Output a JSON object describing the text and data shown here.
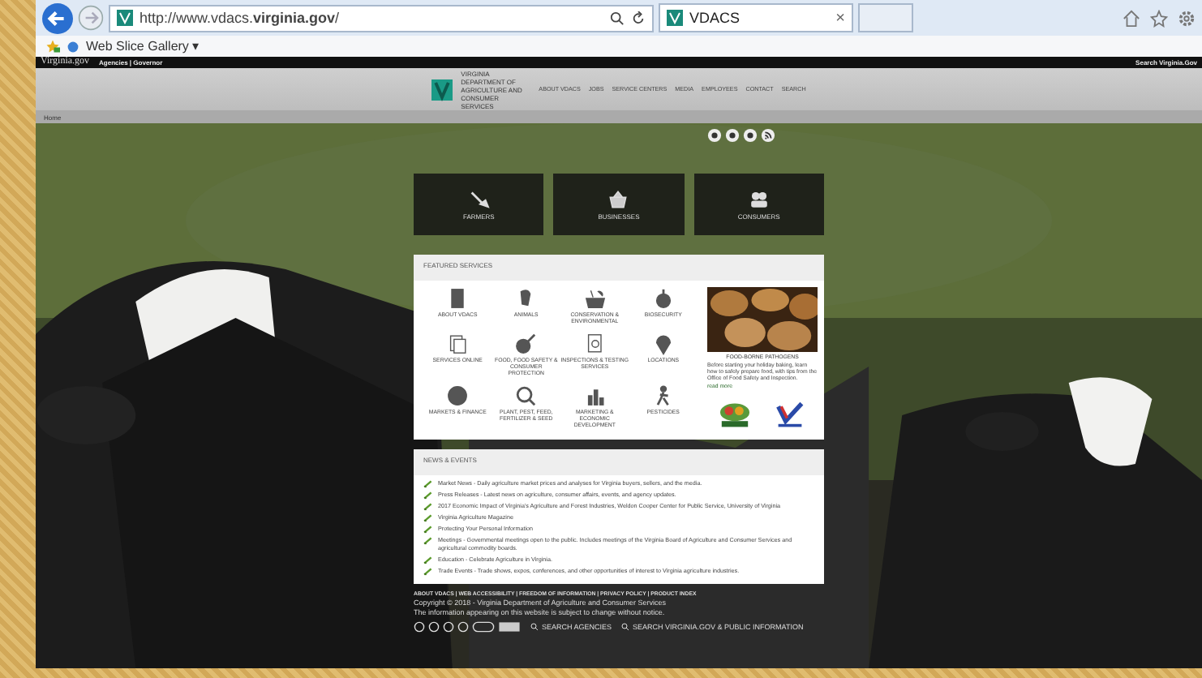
{
  "browser": {
    "address": "http://www.vdacs.**virginia.gov**/",
    "tabs": [
      {
        "label": "VDACS",
        "close": "×",
        "selected": true
      }
    ],
    "favorites": [
      {
        "label": "Web Slice Gallery ▾"
      }
    ]
  },
  "top_bar": {
    "logo": "Virginia.gov",
    "links": "Agencies | Governor",
    "search": "Search Virginia.Gov"
  },
  "header": {
    "agency": "VIRGINIA DEPARTMENT OF AGRICULTURE AND CONSUMER SERVICES",
    "nav": [
      "ABOUT VDACS",
      "JOBS",
      "SERVICE CENTERS",
      "MEDIA",
      "EMPLOYEES",
      "CONTACT",
      "SEARCH"
    ]
  },
  "breadcrumb": "Home",
  "tiles": [
    "FARMERS",
    "BUSINESSES",
    "CONSUMERS"
  ],
  "featured": {
    "title": "FEATURED SERVICES",
    "services": [
      "ABOUT VDACS",
      "ANIMALS",
      "CONSERVATION & ENVIRONMENTAL",
      "BIOSECURITY",
      "SERVICES ONLINE",
      "FOOD, FOOD SAFETY & CONSUMER PROTECTION",
      "INSPECTIONS & TESTING SERVICES",
      "LOCATIONS",
      "MARKETS & FINANCE",
      "PLANT, PEST, FEED, FERTILIZER & SEED",
      "MARKETING & ECONOMIC DEVELOPMENT",
      "PESTICIDES"
    ],
    "spotlight": {
      "caption": "FOOD-BORNE PATHOGENS",
      "text": "Before starting your holiday baking, learn how to safely prepare food, with tips from the Office of Food Safety and Inspection.",
      "link": "read more"
    }
  },
  "news": {
    "title": "NEWS & EVENTS",
    "items": [
      "Market News - Daily agriculture market prices and analyses for Virginia buyers, sellers, and the media.",
      "Press Releases - Latest news on agriculture, consumer affairs, events, and agency updates.",
      "2017 Economic Impact of Virginia's Agriculture and Forest Industries, Weldon Cooper Center for Public Service, University of Virginia",
      "Virginia Agriculture Magazine",
      "Protecting Your Personal Information",
      "Meetings - Governmental meetings open to the public. Includes meetings of the Virginia Board of Agriculture and Consumer Services and agricultural commodity boards.",
      "Education - Celebrate Agriculture in Virginia.",
      "Trade Events - Trade shows, expos, conferences, and other opportunities of interest to Virginia agriculture industries."
    ]
  },
  "footer": {
    "links": "ABOUT VDACS | WEB ACCESSIBILITY | FREEDOM OF INFORMATION | PRIVACY POLICY | PRODUCT INDEX",
    "copyright": "Copyright © 2018 - Virginia Department of Agriculture and Consumer Services",
    "note": "The information appearing on this website is subject to change without notice.",
    "search_links": [
      "SEARCH AGENCIES",
      "SEARCH VIRGINIA.GOV & PUBLIC INFORMATION"
    ]
  }
}
